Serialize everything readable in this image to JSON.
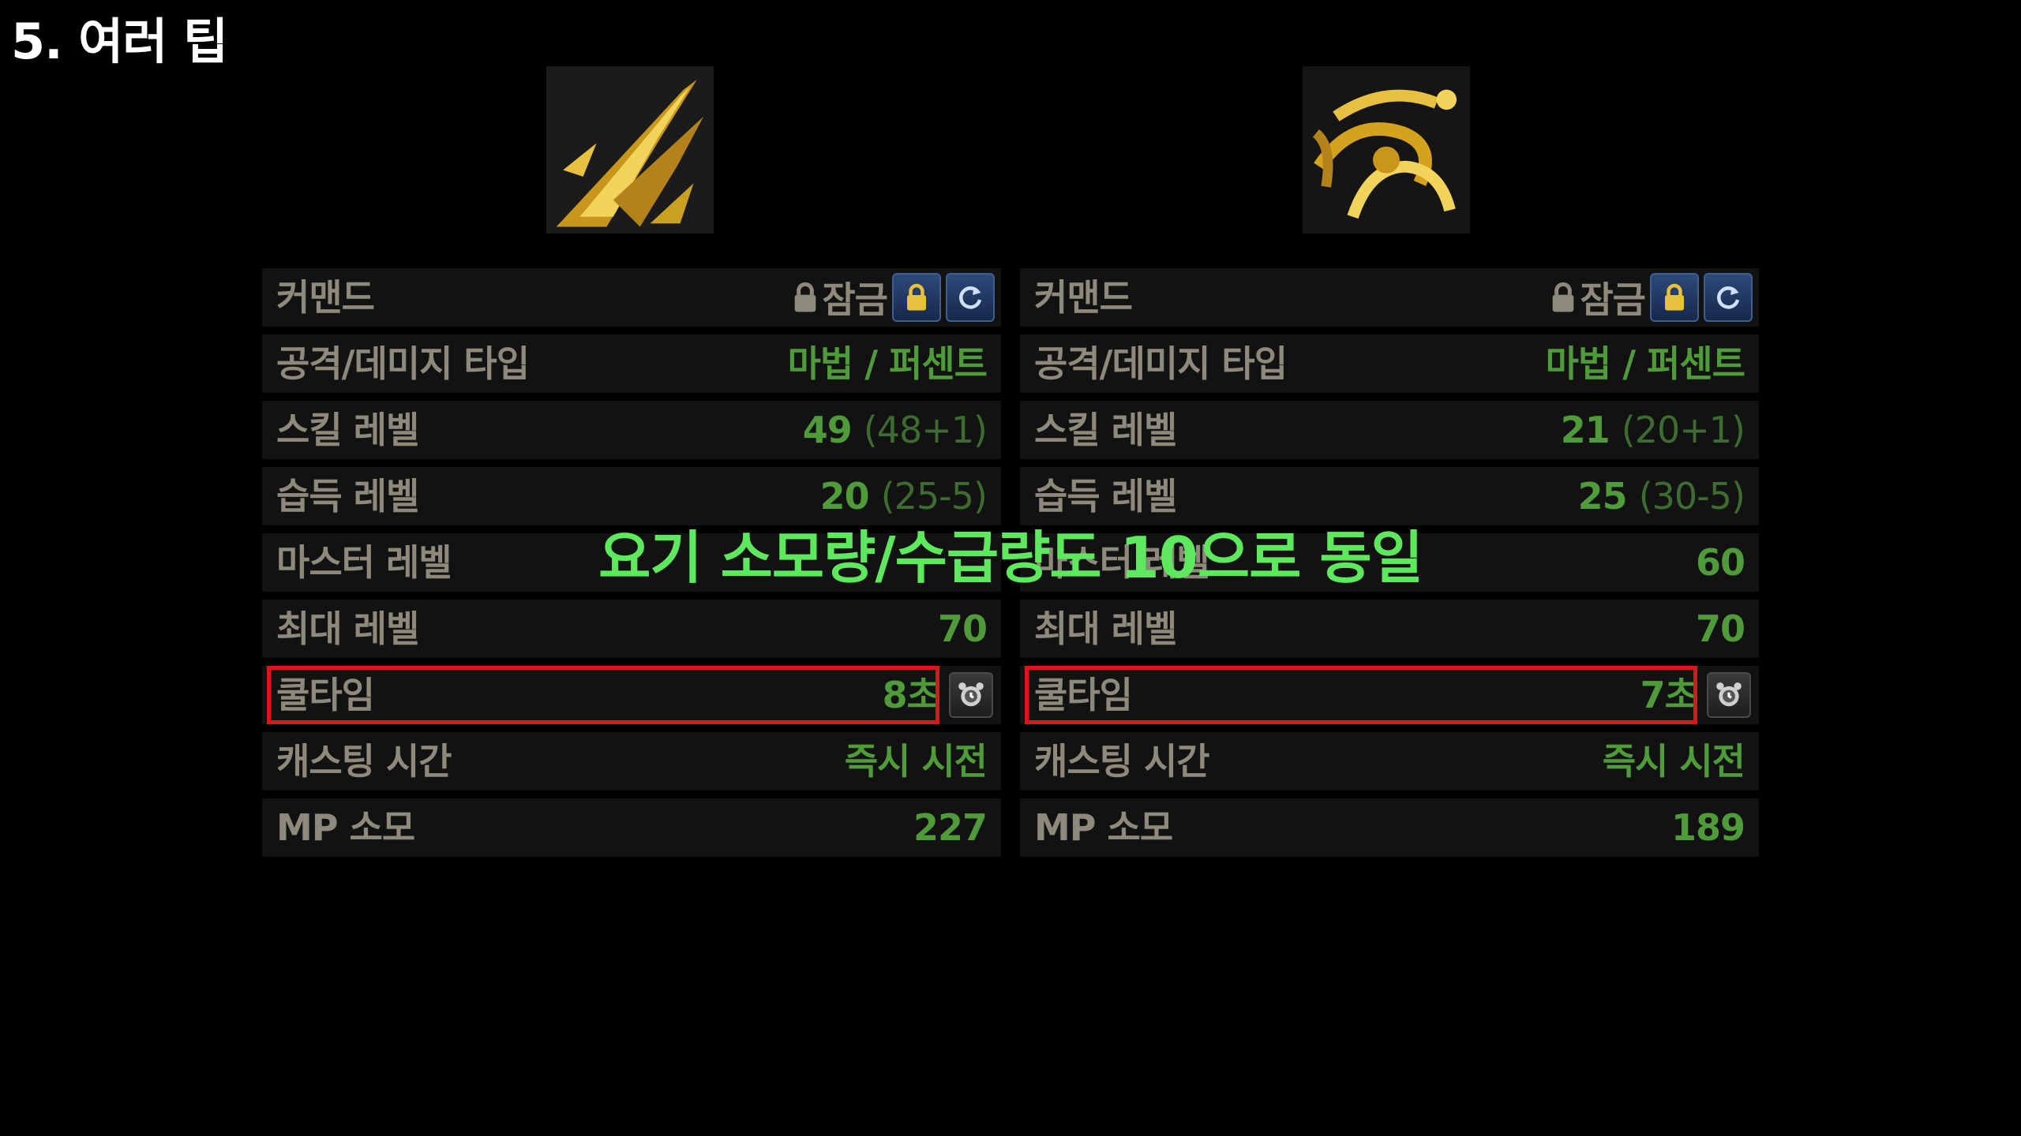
{
  "slide": {
    "title": "5. 여러 팁"
  },
  "caption": "요기 소모량/수급량도 10으로 동일",
  "colors": {
    "value_green": "#4f9a39",
    "label_gray": "#8d8a7c",
    "highlight_red": "#e0141c",
    "caption_green": "#5ee85e",
    "icon_gold": "#d4a21c"
  },
  "left_panel": {
    "icon": "golden-spike-skill-icon",
    "command_label": "커맨드",
    "lock_label": "잠금",
    "attack_type_label": "공격/데미지 타입",
    "attack_type_value": "마법 / 퍼센트",
    "skill_level_label": "스킬 레벨",
    "skill_level_value": "49",
    "skill_level_detail": "(48+1)",
    "acquire_level_label": "습득 레벨",
    "acquire_level_value": "20",
    "acquire_level_detail": "(25-5)",
    "master_level_label": "마스터 레벨",
    "max_level_label": "최대 레벨",
    "max_level_value": "70",
    "cooldown_label": "쿨타임",
    "cooldown_value": "8초",
    "cast_time_label": "캐스팅 시간",
    "cast_time_value": "즉시 시전",
    "mp_label": "MP 소모",
    "mp_value": "227"
  },
  "right_panel": {
    "icon": "golden-vortex-skill-icon",
    "command_label": "커맨드",
    "lock_label": "잠금",
    "attack_type_label": "공격/데미지 타입",
    "attack_type_value": "마법 / 퍼센트",
    "skill_level_label": "스킬 레벨",
    "skill_level_value": "21",
    "skill_level_detail": "(20+1)",
    "acquire_level_label": "습득 레벨",
    "acquire_level_value": "25",
    "acquire_level_detail": "(30-5)",
    "master_level_label": "마스터 레벨",
    "master_level_value": "60",
    "max_level_label": "최대 레벨",
    "max_level_value": "70",
    "cooldown_label": "쿨타임",
    "cooldown_value": "7초",
    "cast_time_label": "캐스팅 시간",
    "cast_time_value": "즉시 시전",
    "mp_label": "MP 소모",
    "mp_value": "189"
  }
}
